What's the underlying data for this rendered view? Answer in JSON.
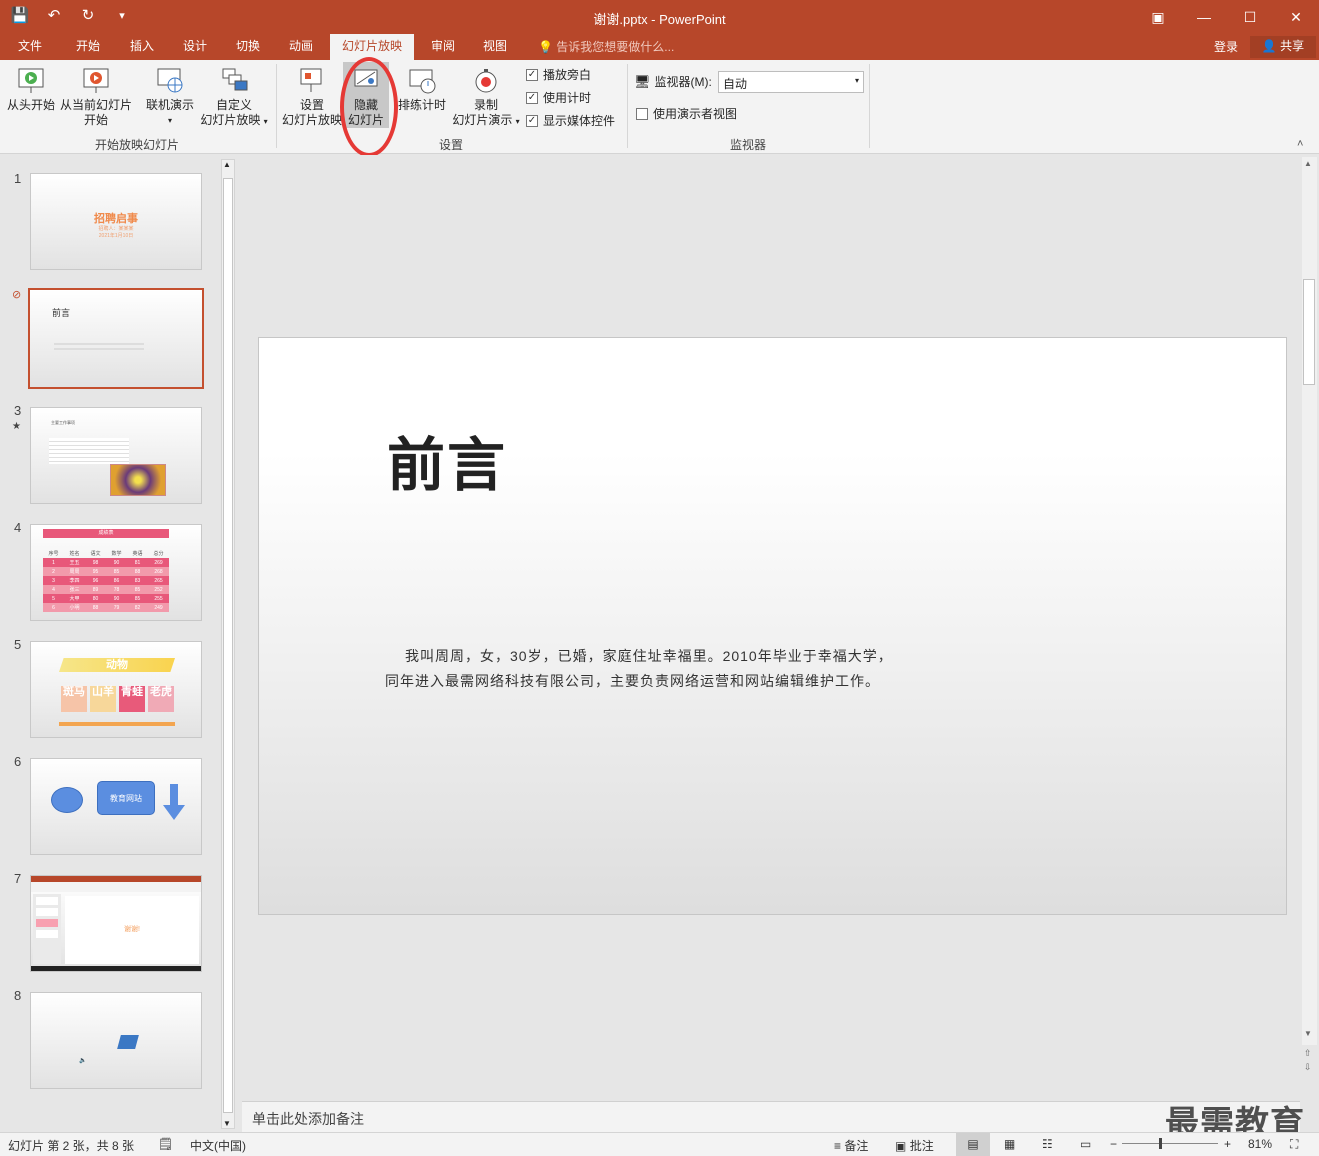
{
  "app": {
    "title": "谢谢.pptx - PowerPoint",
    "accent": "#b7472a"
  },
  "tabs": [
    "文件",
    "开始",
    "插入",
    "设计",
    "切换",
    "动画",
    "幻灯片放映",
    "审阅",
    "视图"
  ],
  "active_tab": "幻灯片放映",
  "tellme": "告诉我您想要做什么...",
  "account": {
    "login": "登录",
    "share": "共享"
  },
  "ribbon": {
    "start_group": {
      "from_beginning": "从头开始",
      "from_current_l1": "从当前幻灯片",
      "from_current_l2": "开始",
      "online_present": "联机演示",
      "custom_l1": "自定义",
      "custom_l2": "幻灯片放映",
      "label": "开始放映幻灯片"
    },
    "setup_group": {
      "setup_l1": "设置",
      "setup_l2": "幻灯片放映",
      "hide_l1": "隐藏",
      "hide_l2": "幻灯片",
      "rehearse": "排练计时",
      "record_l1": "录制",
      "record_l2": "幻灯片演示",
      "play_narration": "播放旁白",
      "use_timings": "使用计时",
      "show_media": "显示媒体控件",
      "label": "设置"
    },
    "monitors_group": {
      "monitor_label": "监视器(M):",
      "monitor_value": "自动",
      "presenter_view": "使用演示者视图",
      "label": "监视器"
    }
  },
  "slides": [
    {
      "num": "1",
      "title": "招聘启事",
      "line1": "招聘人：某某某",
      "line2": "2021年1月10日"
    },
    {
      "num": "2",
      "title": "前言"
    },
    {
      "num": "3",
      "title": "主要工作事项"
    },
    {
      "num": "4",
      "title": "成绩表",
      "headers": [
        "序号",
        "姓名",
        "语文",
        "数学",
        "英语",
        "总分"
      ],
      "rows": [
        [
          "1",
          "王五",
          "98",
          "90",
          "81",
          "269"
        ],
        [
          "2",
          "周周",
          "95",
          "85",
          "88",
          "268"
        ],
        [
          "3",
          "李四",
          "96",
          "86",
          "83",
          "265"
        ],
        [
          "4",
          "张三",
          "89",
          "78",
          "85",
          "252"
        ],
        [
          "5",
          "大甲",
          "80",
          "90",
          "85",
          "255"
        ],
        [
          "6",
          "小明",
          "88",
          "79",
          "82",
          "249"
        ]
      ]
    },
    {
      "num": "5",
      "title": "动物",
      "cards": [
        "斑马",
        "山羊",
        "青蛙",
        "老虎"
      ]
    },
    {
      "num": "6",
      "box": "教育网站"
    },
    {
      "num": "7",
      "text": "谢谢!"
    },
    {
      "num": "8"
    }
  ],
  "current_slide": {
    "title": "前言",
    "body_l1": "我叫周周，女，30岁，已婚，家庭住址幸福里。2010年毕业于幸福大学，",
    "body_l2": "同年进入最需网络科技有限公司，主要负责网络运营和网站编辑维护工作。"
  },
  "notes_placeholder": "单击此处添加备注",
  "status": {
    "slide_info": "幻灯片 第 2 张，共 8 张",
    "language": "中文(中国)",
    "notes": "备注",
    "comments": "批注",
    "zoom": "81%"
  },
  "watermark": "最需教育"
}
